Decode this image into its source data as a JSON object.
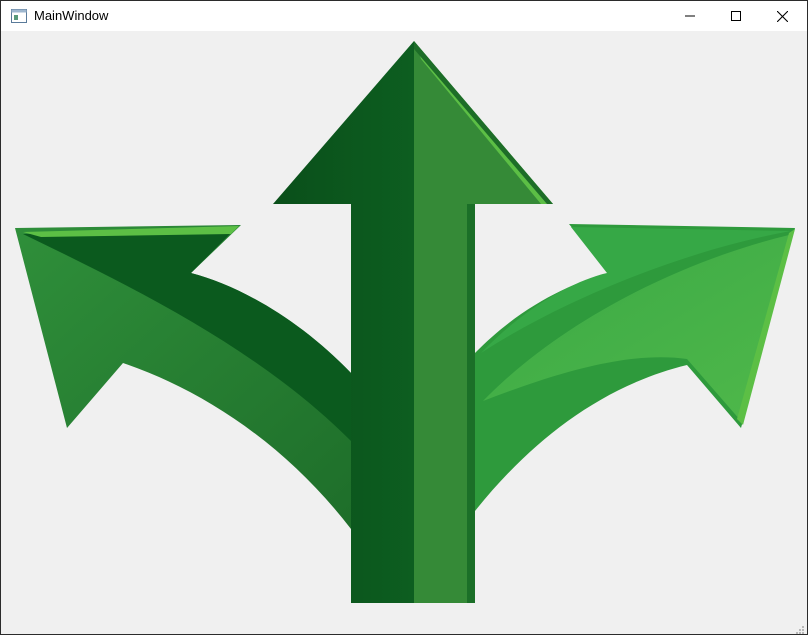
{
  "window": {
    "title": "MainWindow",
    "app_icon": "window-app-icon",
    "controls": {
      "minimize_icon": "minimize-icon",
      "maximize_icon": "maximize-icon",
      "close_icon": "close-icon"
    }
  },
  "content": {
    "image": "three-way-green-arrows",
    "colors": {
      "dark_green": "#0b5a1e",
      "mid_green": "#2e8b3a",
      "light_green": "#4db848",
      "bright_green": "#5cbf45",
      "background": "#f0f0f0"
    }
  }
}
